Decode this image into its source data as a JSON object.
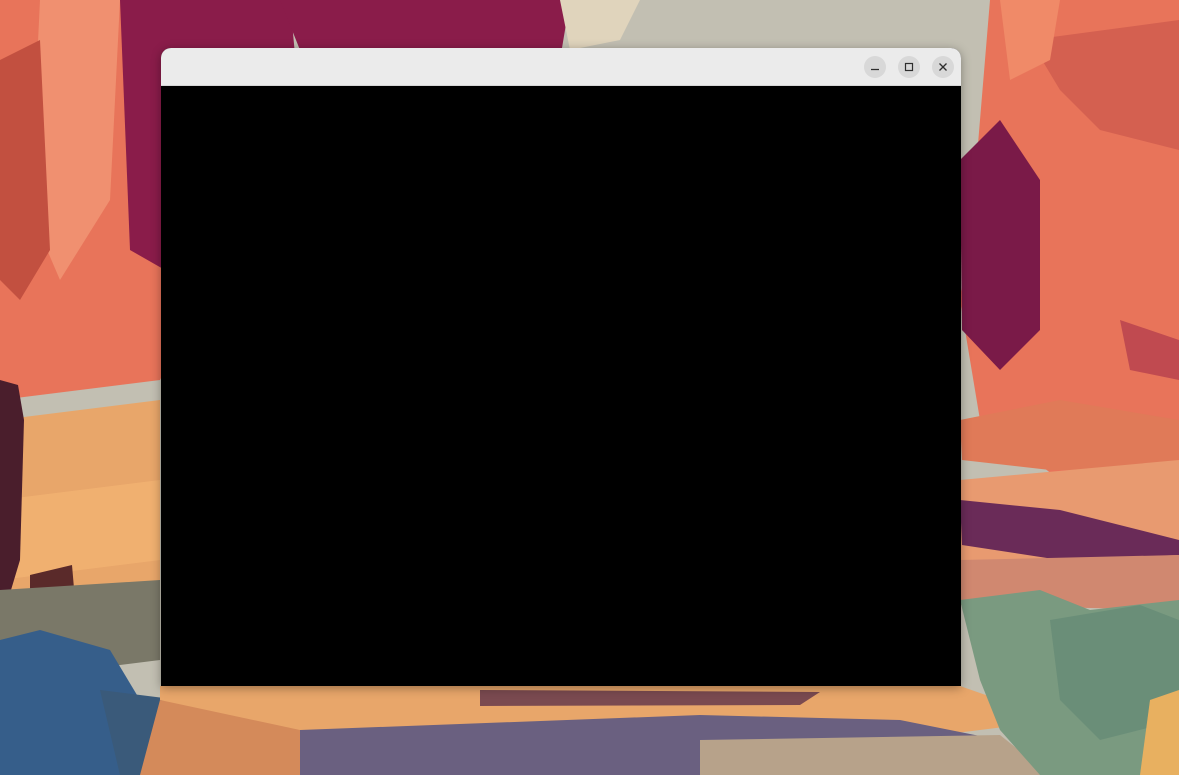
{
  "desktop": {
    "wallpaper_icon": "canyon-landscape-wallpaper",
    "colors": {
      "sky": "#c2bfb2",
      "rock_red": "#8a1c4a",
      "rock_orange": "#e8745a",
      "sand": "#e8a66a",
      "shadow_purple": "#6a2b58",
      "water_blue": "#365e8a",
      "sage": "#7a9a80"
    }
  },
  "window": {
    "title": "",
    "titlebar_color": "#ebebeb",
    "content_color": "#000000",
    "controls": {
      "minimize_icon": "minimize-icon",
      "maximize_icon": "maximize-icon",
      "close_icon": "close-icon"
    }
  }
}
